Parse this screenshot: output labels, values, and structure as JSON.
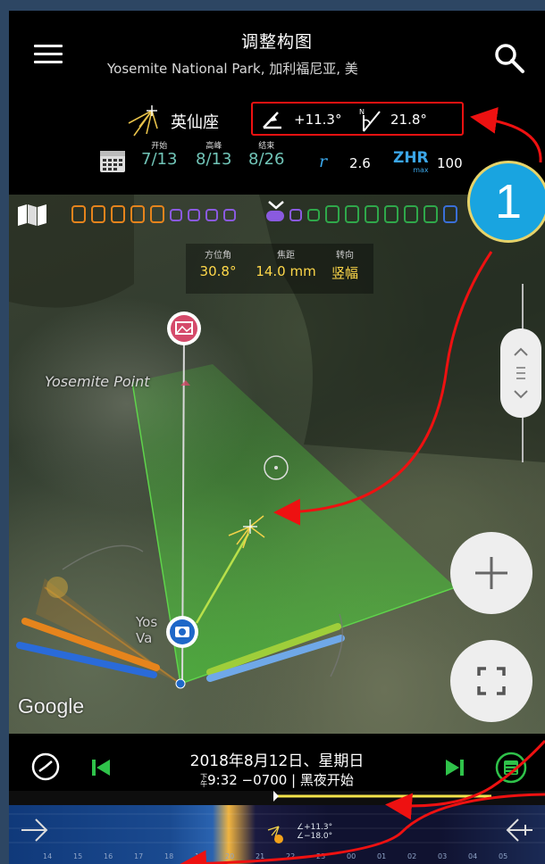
{
  "header": {
    "title": "调整构图",
    "subtitle": "Yosemite National Park, 加利福尼亚, 美"
  },
  "shower": {
    "name": "英仙座",
    "altitude": "+11.3°",
    "azimuth": "21.8°",
    "dates": [
      {
        "label": "开始",
        "value": "7/13"
      },
      {
        "label": "高峰",
        "value": "8/13"
      },
      {
        "label": "结束",
        "value": "8/26"
      }
    ],
    "r_label": "r",
    "r_value": "2.6",
    "zhr_label": "ZHR",
    "zhr_sub": "max",
    "zhr_value": "100"
  },
  "params": [
    {
      "label": "方位角",
      "value": "30.8°"
    },
    {
      "label": "焦距",
      "value": "14.0 mm"
    },
    {
      "label": "转向",
      "value": "竖幅"
    }
  ],
  "map": {
    "place_label": "Yosemite Point",
    "place_label_2": "Yos",
    "place_label_3": "Va",
    "attribution": "Google"
  },
  "badge": "1",
  "bottom": {
    "date": "2018年8月12日、星期日",
    "time_prefix": "下午",
    "time": "9:32 −0700 | 黑夜开始"
  },
  "timeline": {
    "hours": [
      "14",
      "15",
      "16",
      "17",
      "18",
      "19",
      "20",
      "21",
      "22",
      "23",
      "00",
      "01",
      "02",
      "03",
      "04",
      "05"
    ],
    "alt_labels": [
      "∠+11.3°",
      "∠−18.0°"
    ]
  },
  "colors": {
    "accent_teal": "#71c5b8",
    "accent_blue": "#3ba6e8",
    "param_yellow": "#ffd84a",
    "annotation_red": "#e11111",
    "fov_green": "#4bbf3a",
    "nav_green": "#2fc24a"
  }
}
